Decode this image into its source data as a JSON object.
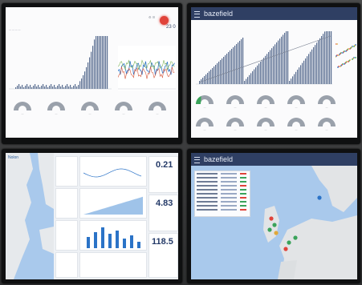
{
  "screens": {
    "top_left": {
      "header_number": "23 0"
    },
    "top_right": {
      "app_title": "bazefield"
    },
    "bottom_left": {
      "sidebar_label": "Nolon",
      "kpis": [
        {
          "value": "0.21"
        },
        {
          "value": "4.83"
        },
        {
          "value": "118.5"
        }
      ]
    },
    "bottom_right": {
      "app_title": "bazefield"
    }
  },
  "colors": {
    "header_bar": "#2f3f63",
    "bar_series": "#5a6e91",
    "map_land": "#dfe1e2",
    "map_sea": "#9fc3e9",
    "status_red": "#e0433a",
    "status_green": "#3aa35a"
  }
}
